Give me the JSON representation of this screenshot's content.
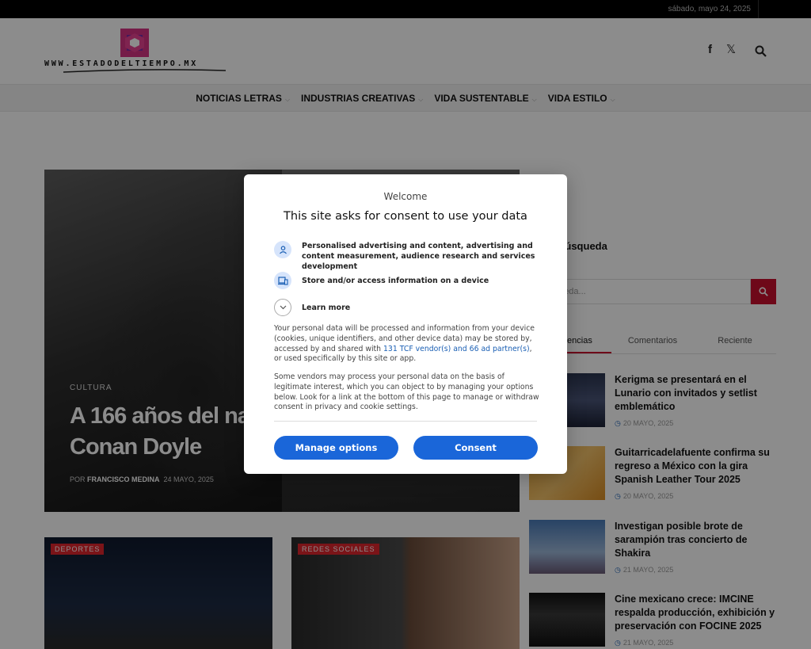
{
  "topbar": {
    "date": "sábado, mayo 24, 2025"
  },
  "header": {
    "logo_text": "WWW.ESTADODELTIEMPO.MX",
    "icons": [
      "facebook-icon",
      "x-twitter-icon",
      "search-icon"
    ],
    "facebook_glyph": "f",
    "x_glyph": "𝕏"
  },
  "nav": {
    "items": [
      {
        "label": "NOTICIAS LETRAS"
      },
      {
        "label": "INDUSTRIAS CREATIVAS"
      },
      {
        "label": "VIDA SUSTENTABLE"
      },
      {
        "label": "VIDA ESTILO"
      }
    ]
  },
  "hero": {
    "category": "CULTURA",
    "title": "A 166 años del nacimiento de Sir Arthur Conan Doyle",
    "byline_prefix": "POR",
    "author": "FRANCISCO MEDINA",
    "date": "24 MAYO, 2025"
  },
  "cards": [
    {
      "category": "DEPORTES"
    },
    {
      "category": "REDES SOCIALES"
    }
  ],
  "sidebar": {
    "heading": "Búsqueda",
    "search_placeholder": "Búsqueda...",
    "tabs": [
      "Tendencias",
      "Comentarios",
      "Reciente"
    ],
    "active_tab": 0,
    "posts": [
      {
        "title": "Kerigma se presentará en el Lunario con invitados y setlist emblemático",
        "date": "20 MAYO, 2025"
      },
      {
        "title": "Guitarricadelafuente confirma su regreso a México con la gira Spanish Leather Tour 2025",
        "date": "20 MAYO, 2025"
      },
      {
        "title": "Investigan posible brote de sarampión tras concierto de Shakira",
        "date": "21 MAYO, 2025"
      },
      {
        "title": "Cine mexicano crece: IMCINE respalda producción, exhibición y preservación con FOCINE 2025",
        "date": "21 MAYO, 2025"
      }
    ]
  },
  "consent": {
    "welcome": "Welcome",
    "title": "This site asks for consent to use your data",
    "purposes": [
      {
        "text": "Personalised advertising and content, advertising and content measurement, audience research and services development",
        "icon": "person-icon"
      },
      {
        "text": "Store and/or access information on a device",
        "icon": "devices-icon"
      },
      {
        "text": "Learn more",
        "icon": "chevron-down-icon"
      }
    ],
    "para1_before": "Your personal data will be processed and information from your device (cookies, unique identifiers, and other device data) may be stored by, accessed by and shared with ",
    "para1_link": "131 TCF vendor(s) and 66 ad partner(s)",
    "para1_after": ", or used specifically by this site or app.",
    "para2": "Some vendors may process your personal data on the basis of legitimate interest, which you can object to by managing your options below. Look for a link at the bottom of this page to manage or withdraw consent in privacy and cookie settings.",
    "manage_label": "Manage options",
    "consent_label": "Consent"
  },
  "colors": {
    "accent_red": "#c8102e",
    "consent_blue": "#1a66d9",
    "date_clock": "#1a5fb4"
  }
}
